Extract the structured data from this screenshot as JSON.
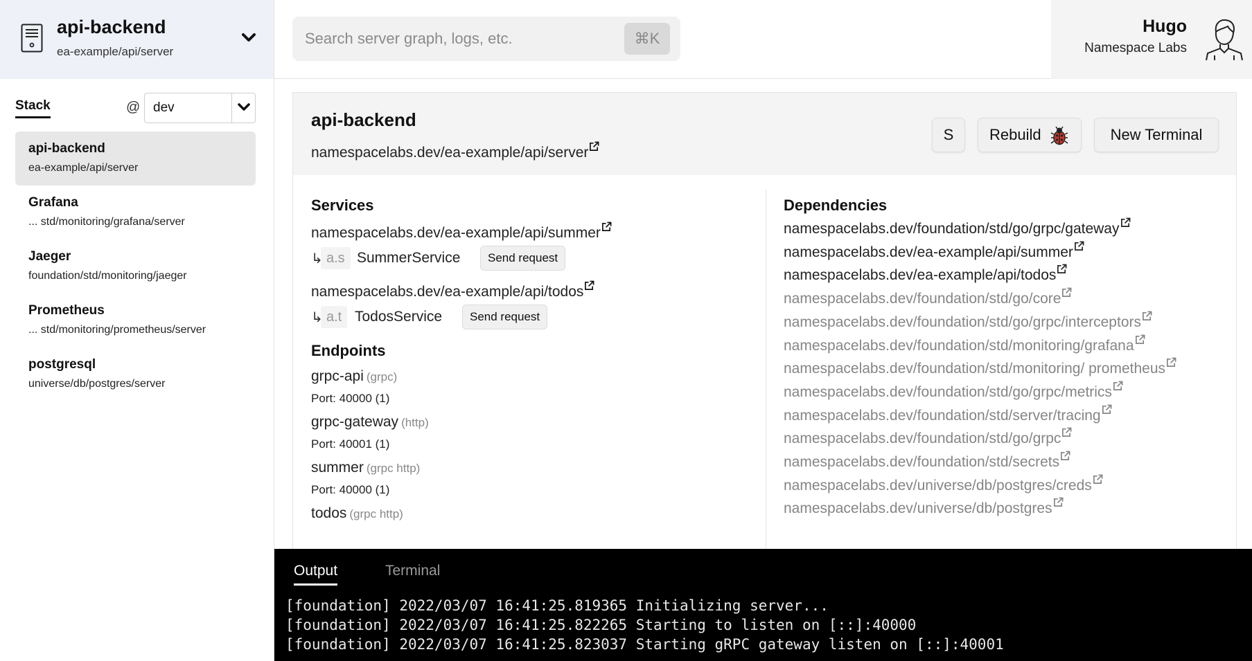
{
  "server_switcher": {
    "name": "api-backend",
    "path": "ea-example/api/server"
  },
  "search": {
    "placeholder": "Search server graph, logs, etc.",
    "shortcut": "⌘K"
  },
  "user": {
    "name": "Hugo",
    "org": "Namespace Labs"
  },
  "sidebar": {
    "tab_label": "Stack",
    "env_at": "@",
    "env_value": "dev",
    "items": [
      {
        "name": "api-backend",
        "path": "ea-example/api/server",
        "active": true
      },
      {
        "name": "Grafana",
        "path": "... std/monitoring/grafana/server"
      },
      {
        "name": "Jaeger",
        "path": "foundation/std/monitoring/jaeger"
      },
      {
        "name": "Prometheus",
        "path": "... std/monitoring/prometheus/server"
      },
      {
        "name": "postgresql",
        "path": "universe/db/postgres/server"
      }
    ]
  },
  "main": {
    "title": "api-backend",
    "url": "namespacelabs.dev/ea-example/api/server",
    "buttons": {
      "s": "S",
      "rebuild": "Rebuild",
      "new_terminal": "New Terminal"
    },
    "services_title": "Services",
    "services": [
      {
        "url": "namespacelabs.dev/ea-example/api/summer",
        "arrow": "↳",
        "tag": "a.s",
        "service": "SummerService",
        "action": "Send request"
      },
      {
        "url": "namespacelabs.dev/ea-example/api/todos",
        "arrow": "↳",
        "tag": "a.t",
        "service": "TodosService",
        "action": "Send request"
      }
    ],
    "endpoints_title": "Endpoints",
    "endpoints": [
      {
        "name": "grpc-api",
        "proto": "(grpc)",
        "port": "Port: 40000 (1)"
      },
      {
        "name": "grpc-gateway",
        "proto": "(http)",
        "port": "Port: 40001 (1)"
      },
      {
        "name": "summer",
        "proto": "(grpc http)",
        "port": "Port: 40000 (1)"
      },
      {
        "name": "todos",
        "proto": "(grpc http)",
        "port": ""
      }
    ],
    "dependencies_title": "Dependencies",
    "dependencies": [
      {
        "url": "namespacelabs.dev/foundation/std/go/grpc/gateway",
        "muted": false
      },
      {
        "url": "namespacelabs.dev/ea-example/api/summer",
        "muted": false
      },
      {
        "url": "namespacelabs.dev/ea-example/api/todos",
        "muted": false
      },
      {
        "url": "namespacelabs.dev/foundation/std/go/core",
        "muted": true
      },
      {
        "url": "namespacelabs.dev/foundation/std/go/grpc/interceptors",
        "muted": true
      },
      {
        "url": "namespacelabs.dev/foundation/std/monitoring/grafana",
        "muted": true
      },
      {
        "url": "namespacelabs.dev/foundation/std/monitoring/ prometheus",
        "muted": true
      },
      {
        "url": "namespacelabs.dev/foundation/std/go/grpc/metrics",
        "muted": true
      },
      {
        "url": "namespacelabs.dev/foundation/std/server/tracing",
        "muted": true
      },
      {
        "url": "namespacelabs.dev/foundation/std/go/grpc",
        "muted": true
      },
      {
        "url": "namespacelabs.dev/foundation/std/secrets",
        "muted": true
      },
      {
        "url": "namespacelabs.dev/universe/db/postgres/creds",
        "muted": true
      },
      {
        "url": "namespacelabs.dev/universe/db/postgres",
        "muted": true
      }
    ]
  },
  "console": {
    "tabs": {
      "output": "Output",
      "terminal": "Terminal"
    },
    "lines": [
      "[foundation] 2022/03/07 16:41:25.819365 Initializing server...",
      "[foundation] 2022/03/07 16:41:25.822265 Starting to listen on [::]:40000",
      "[foundation] 2022/03/07 16:41:25.823037 Starting gRPC gateway listen on [::]:40001"
    ]
  },
  "colors": {
    "header_bg": "#eef1f7",
    "panel_bg": "#f4f4f4",
    "console_bg": "#000000",
    "muted_text": "#858585"
  },
  "icons": {
    "server": "server-icon",
    "dropdown": "chevron-down-icon",
    "avatar": "user-avatar-icon",
    "bug": "bug-icon",
    "external": "external-link-icon"
  }
}
